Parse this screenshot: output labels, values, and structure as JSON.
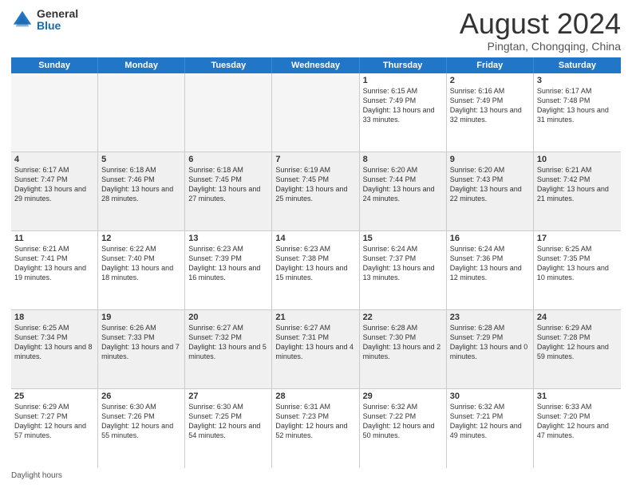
{
  "logo": {
    "general": "General",
    "blue": "Blue"
  },
  "header": {
    "month": "August 2024",
    "location": "Pingtan, Chongqing, China"
  },
  "weekdays": [
    "Sunday",
    "Monday",
    "Tuesday",
    "Wednesday",
    "Thursday",
    "Friday",
    "Saturday"
  ],
  "footer": {
    "label": "Daylight hours"
  },
  "rows": [
    [
      {
        "day": "",
        "info": "",
        "empty": true
      },
      {
        "day": "",
        "info": "",
        "empty": true
      },
      {
        "day": "",
        "info": "",
        "empty": true
      },
      {
        "day": "",
        "info": "",
        "empty": true
      },
      {
        "day": "1",
        "info": "Sunrise: 6:15 AM\nSunset: 7:49 PM\nDaylight: 13 hours and 33 minutes."
      },
      {
        "day": "2",
        "info": "Sunrise: 6:16 AM\nSunset: 7:49 PM\nDaylight: 13 hours and 32 minutes."
      },
      {
        "day": "3",
        "info": "Sunrise: 6:17 AM\nSunset: 7:48 PM\nDaylight: 13 hours and 31 minutes."
      }
    ],
    [
      {
        "day": "4",
        "info": "Sunrise: 6:17 AM\nSunset: 7:47 PM\nDaylight: 13 hours and 29 minutes."
      },
      {
        "day": "5",
        "info": "Sunrise: 6:18 AM\nSunset: 7:46 PM\nDaylight: 13 hours and 28 minutes."
      },
      {
        "day": "6",
        "info": "Sunrise: 6:18 AM\nSunset: 7:45 PM\nDaylight: 13 hours and 27 minutes."
      },
      {
        "day": "7",
        "info": "Sunrise: 6:19 AM\nSunset: 7:45 PM\nDaylight: 13 hours and 25 minutes."
      },
      {
        "day": "8",
        "info": "Sunrise: 6:20 AM\nSunset: 7:44 PM\nDaylight: 13 hours and 24 minutes."
      },
      {
        "day": "9",
        "info": "Sunrise: 6:20 AM\nSunset: 7:43 PM\nDaylight: 13 hours and 22 minutes."
      },
      {
        "day": "10",
        "info": "Sunrise: 6:21 AM\nSunset: 7:42 PM\nDaylight: 13 hours and 21 minutes."
      }
    ],
    [
      {
        "day": "11",
        "info": "Sunrise: 6:21 AM\nSunset: 7:41 PM\nDaylight: 13 hours and 19 minutes."
      },
      {
        "day": "12",
        "info": "Sunrise: 6:22 AM\nSunset: 7:40 PM\nDaylight: 13 hours and 18 minutes."
      },
      {
        "day": "13",
        "info": "Sunrise: 6:23 AM\nSunset: 7:39 PM\nDaylight: 13 hours and 16 minutes."
      },
      {
        "day": "14",
        "info": "Sunrise: 6:23 AM\nSunset: 7:38 PM\nDaylight: 13 hours and 15 minutes."
      },
      {
        "day": "15",
        "info": "Sunrise: 6:24 AM\nSunset: 7:37 PM\nDaylight: 13 hours and 13 minutes."
      },
      {
        "day": "16",
        "info": "Sunrise: 6:24 AM\nSunset: 7:36 PM\nDaylight: 13 hours and 12 minutes."
      },
      {
        "day": "17",
        "info": "Sunrise: 6:25 AM\nSunset: 7:35 PM\nDaylight: 13 hours and 10 minutes."
      }
    ],
    [
      {
        "day": "18",
        "info": "Sunrise: 6:25 AM\nSunset: 7:34 PM\nDaylight: 13 hours and 8 minutes."
      },
      {
        "day": "19",
        "info": "Sunrise: 6:26 AM\nSunset: 7:33 PM\nDaylight: 13 hours and 7 minutes."
      },
      {
        "day": "20",
        "info": "Sunrise: 6:27 AM\nSunset: 7:32 PM\nDaylight: 13 hours and 5 minutes."
      },
      {
        "day": "21",
        "info": "Sunrise: 6:27 AM\nSunset: 7:31 PM\nDaylight: 13 hours and 4 minutes."
      },
      {
        "day": "22",
        "info": "Sunrise: 6:28 AM\nSunset: 7:30 PM\nDaylight: 13 hours and 2 minutes."
      },
      {
        "day": "23",
        "info": "Sunrise: 6:28 AM\nSunset: 7:29 PM\nDaylight: 13 hours and 0 minutes."
      },
      {
        "day": "24",
        "info": "Sunrise: 6:29 AM\nSunset: 7:28 PM\nDaylight: 12 hours and 59 minutes."
      }
    ],
    [
      {
        "day": "25",
        "info": "Sunrise: 6:29 AM\nSunset: 7:27 PM\nDaylight: 12 hours and 57 minutes."
      },
      {
        "day": "26",
        "info": "Sunrise: 6:30 AM\nSunset: 7:26 PM\nDaylight: 12 hours and 55 minutes."
      },
      {
        "day": "27",
        "info": "Sunrise: 6:30 AM\nSunset: 7:25 PM\nDaylight: 12 hours and 54 minutes."
      },
      {
        "day": "28",
        "info": "Sunrise: 6:31 AM\nSunset: 7:23 PM\nDaylight: 12 hours and 52 minutes."
      },
      {
        "day": "29",
        "info": "Sunrise: 6:32 AM\nSunset: 7:22 PM\nDaylight: 12 hours and 50 minutes."
      },
      {
        "day": "30",
        "info": "Sunrise: 6:32 AM\nSunset: 7:21 PM\nDaylight: 12 hours and 49 minutes."
      },
      {
        "day": "31",
        "info": "Sunrise: 6:33 AM\nSunset: 7:20 PM\nDaylight: 12 hours and 47 minutes."
      }
    ]
  ]
}
